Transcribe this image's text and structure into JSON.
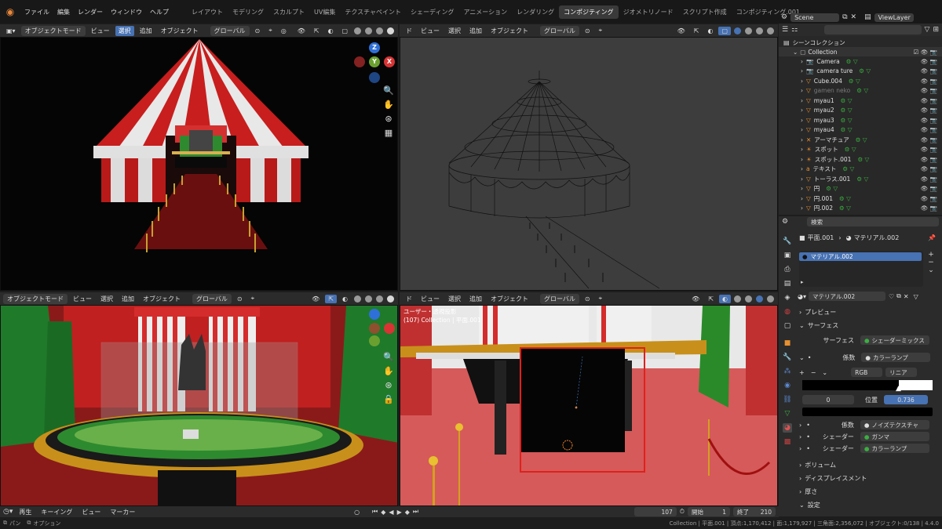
{
  "menubar": {
    "items": [
      "ファイル",
      "編集",
      "レンダー",
      "ウィンドウ",
      "ヘルプ"
    ],
    "workspaces": [
      "レイアウト",
      "モデリング",
      "スカルプト",
      "UV編集",
      "テクスチャペイント",
      "シェーディング",
      "アニメーション",
      "レンダリング",
      "コンポジティング",
      "ジオメトリノード",
      "スクリプト作成",
      "コンポジティング.001"
    ],
    "active_workspace": "コンポジティング",
    "scene": "Scene",
    "view_layer": "ViewLayer"
  },
  "vp1": {
    "mode": "オブジェクトモード",
    "view": "ビュー",
    "select": "選択",
    "add": "追加",
    "object": "オブジェクト",
    "orient": "グローバル",
    "gizmo": {
      "x": "X",
      "y": "Y",
      "z": "Z"
    }
  },
  "vp2": {
    "view": "ビュー",
    "select": "選択",
    "add": "追加",
    "object": "オブジェクト",
    "orient": "グローバル"
  },
  "vp3": {
    "mode": "オブジェクトモード",
    "view": "ビュー",
    "select": "選択",
    "add": "追加",
    "object": "オブジェクト",
    "orient": "グローバル"
  },
  "vp4": {
    "view": "ビュー",
    "select": "選択",
    "add": "追加",
    "object": "オブジェクト",
    "orient": "グローバル",
    "overlay_title": "ユーザー・透視投影",
    "overlay_sub": "(107) Collection | 平面.001"
  },
  "outliner": {
    "search_placeholder": "",
    "title": "シーンコレクション",
    "collection": "Collection",
    "items": [
      {
        "name": "Camera",
        "dim": false
      },
      {
        "name": "camera ture",
        "dim": false
      },
      {
        "name": "Cube.004",
        "dim": false
      },
      {
        "name": "gamen neko",
        "dim": true
      },
      {
        "name": "myau1",
        "dim": false
      },
      {
        "name": "myau2",
        "dim": false
      },
      {
        "name": "myau3",
        "dim": false
      },
      {
        "name": "myau4",
        "dim": false
      },
      {
        "name": "アーマチュア",
        "dim": false
      },
      {
        "name": "スポット",
        "dim": false
      },
      {
        "name": "スポット.001",
        "dim": false
      },
      {
        "name": "テキスト",
        "dim": false
      },
      {
        "name": "トーラス.001",
        "dim": false
      },
      {
        "name": "円",
        "dim": false
      },
      {
        "name": "円.001",
        "dim": false
      },
      {
        "name": "円.002",
        "dim": false
      }
    ]
  },
  "properties": {
    "search_placeholder": "検索",
    "breadcrumb_obj": "平面.001",
    "breadcrumb_mat": "マテリアル.002",
    "slot_name": "マテリアル.002",
    "material_name": "マテリアル.002",
    "sections": {
      "preview": "プレビュー",
      "surface": "サーフェス",
      "volume": "ボリューム",
      "displacement": "ディスプレイスメント",
      "thickness": "厚さ",
      "settings": "設定"
    },
    "surface_label": "サーフェス",
    "surface_value": "シェーダーミックス",
    "factor_label": "係数",
    "factor_value": "カラーランプ",
    "rgb": "RGB",
    "interp": "リニア",
    "stop_index": "0",
    "pos_label": "位置",
    "pos_value": "0.736",
    "factor2_label": "係数",
    "factor2_value": "ノイズテクスチャ",
    "shader1_label": "シェーダー",
    "shader1_value": "ガンマ",
    "shader2_label": "シェーダー",
    "shader2_value": "カラーランプ"
  },
  "timeline": {
    "playback": "再生",
    "keying": "キーイング",
    "view": "ビュー",
    "marker": "マーカー",
    "current_frame": "107",
    "start_label": "開始",
    "start": "1",
    "end_label": "終了",
    "end": "210"
  },
  "statusbar": {
    "left1": "パン",
    "left2": "オプション",
    "right": "Collection | 平面.001 | 頂点:1,170,412 | 面:1,179,927 | 三角面:2,356,072 | オブジェクト:0/138 | 4.4.0"
  },
  "colors": {
    "accent": "#4772b3",
    "active_tab": "#3a3a3a",
    "selection_box": "#e0201c"
  }
}
